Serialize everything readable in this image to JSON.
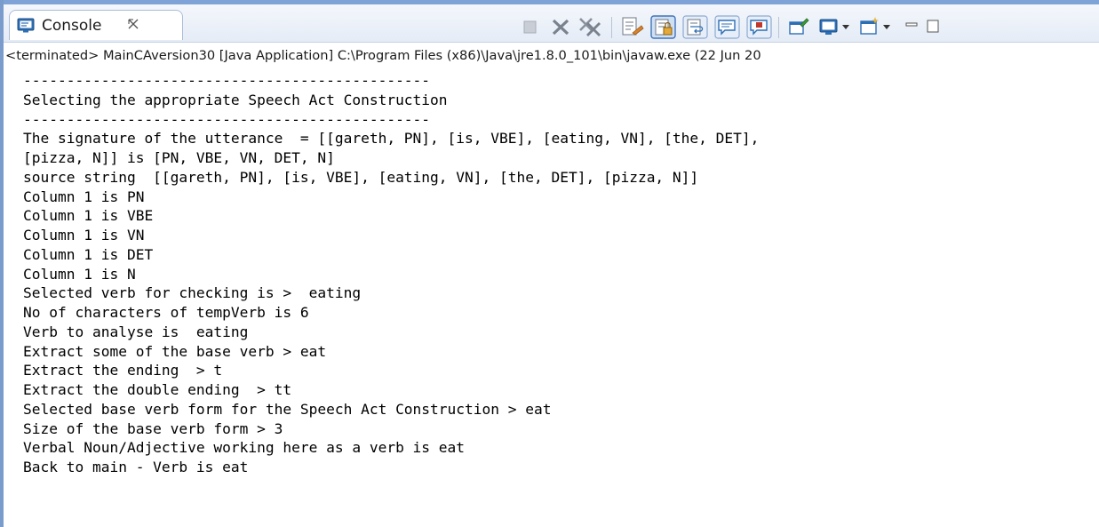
{
  "view": {
    "tab_title": "Console",
    "tab_close_icon": "close-icon",
    "status_line": "<terminated> MainCAversion30 [Java Application] C:\\Program Files (x86)\\Java\\jre1.8.0_101\\bin\\javaw.exe (22 Jun 20"
  },
  "toolbar": [
    {
      "name": "terminate-button",
      "icon": "stop-square-icon"
    },
    {
      "name": "remove-launch-button",
      "icon": "remove-x-icon"
    },
    {
      "name": "remove-all-terminated-button",
      "icon": "remove-all-x-icon"
    },
    {
      "name": "clear-console-button",
      "icon": "clear-console-icon"
    },
    {
      "name": "scroll-lock-button",
      "icon": "scroll-lock-icon"
    },
    {
      "name": "word-wrap-button",
      "icon": "word-wrap-icon"
    },
    {
      "name": "show-on-stdout-button",
      "icon": "stdout-icon"
    },
    {
      "name": "show-on-stderr-button",
      "icon": "stderr-icon"
    },
    {
      "name": "pin-console-button",
      "icon": "pin-icon"
    },
    {
      "name": "display-console-button",
      "icon": "monitor-icon"
    },
    {
      "name": "open-console-button",
      "icon": "new-console-icon"
    },
    {
      "name": "minimize-button",
      "icon": "minimize-icon"
    },
    {
      "name": "maximize-button",
      "icon": "maximize-icon"
    }
  ],
  "colors": {
    "accent": "#7fa3d6",
    "icon_blue": "#2d6fb5",
    "icon_orange": "#d9822b",
    "icon_red": "#c0392b"
  },
  "console": {
    "lines": [
      "-----------------------------------------------",
      "Selecting the appropriate Speech Act Construction",
      "-----------------------------------------------",
      "The signature of the utterance  = [[gareth, PN], [is, VBE], [eating, VN], [the, DET],",
      "[pizza, N]] is [PN, VBE, VN, DET, N]",
      "source string  [[gareth, PN], [is, VBE], [eating, VN], [the, DET], [pizza, N]]",
      "Column 1 is PN",
      "Column 1 is VBE",
      "Column 1 is VN",
      "Column 1 is DET",
      "Column 1 is N",
      "Selected verb for checking is >  eating",
      "No of characters of tempVerb is 6",
      "Verb to analyse is  eating",
      "Extract some of the base verb > eat",
      "Extract the ending  > t",
      "Extract the double ending  > tt",
      "Selected base verb form for the Speech Act Construction > eat",
      "Size of the base verb form > 3",
      "Verbal Noun/Adjective working here as a verb is eat",
      "Back to main - Verb is eat"
    ]
  }
}
